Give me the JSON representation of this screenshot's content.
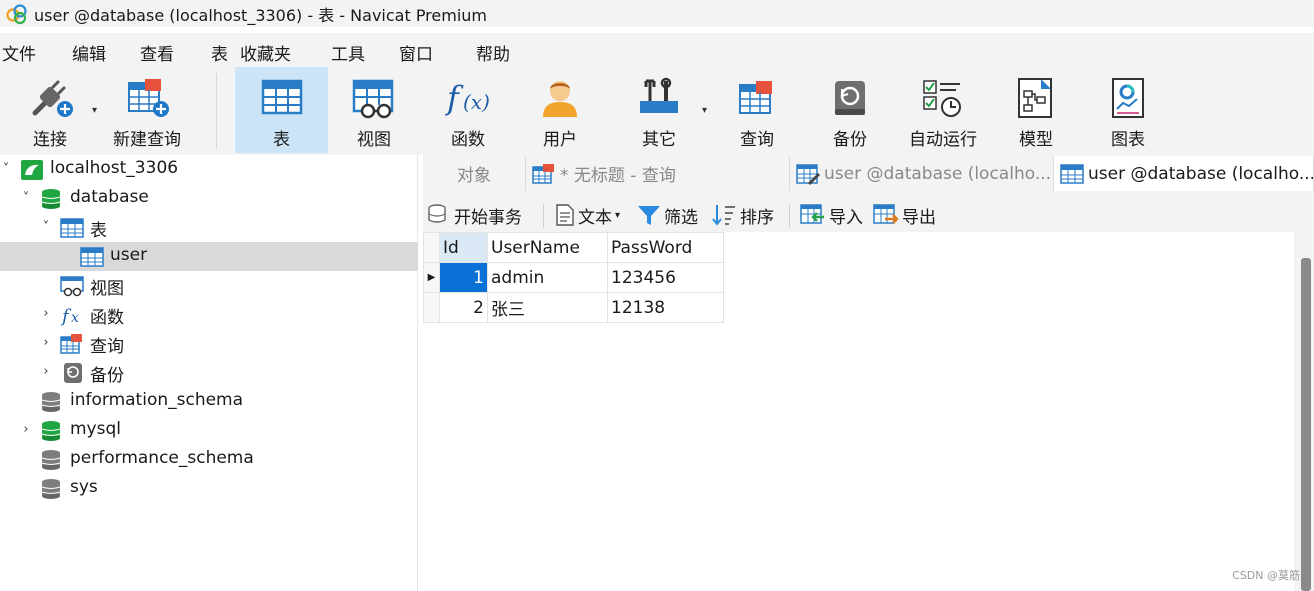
{
  "window": {
    "title": "user @database (localhost_3306) - 表 - Navicat Premium"
  },
  "menu": [
    "文件",
    "编辑",
    "查看",
    "表",
    "收藏夹",
    "工具",
    "窗口",
    "帮助"
  ],
  "toolbar": {
    "connect": "连接",
    "new_query": "新建查询",
    "table": "表",
    "view": "视图",
    "function": "函数",
    "user": "用户",
    "other": "其它",
    "query": "查询",
    "backup": "备份",
    "automation": "自动运行",
    "model": "模型",
    "chart": "图表"
  },
  "tree": {
    "connection": "localhost_3306",
    "database": "database",
    "tables_group": "表",
    "table_user": "user",
    "views": "视图",
    "functions": "函数",
    "queries": "查询",
    "backups": "备份",
    "db2": "information_schema",
    "db3": "mysql",
    "db4": "performance_schema",
    "db5": "sys"
  },
  "tabs": {
    "objects": "对象",
    "query_tab": "* 无标题 - 查询",
    "tab3": "user @database (localho...",
    "tab4": "user @database (localho..."
  },
  "subtoolbar": {
    "begin_transaction": "开始事务",
    "text": "文本",
    "filter": "筛选",
    "sort": "排序",
    "import": "导入",
    "export": "导出"
  },
  "grid": {
    "columns": [
      "Id",
      "UserName",
      "PassWord"
    ],
    "rows": [
      {
        "id": "1",
        "username": "admin",
        "password": "123456"
      },
      {
        "id": "2",
        "username": "张三",
        "password": "12138"
      }
    ]
  },
  "watermark": "CSDN @莫筋",
  "colors": {
    "selection": "#0a72d6",
    "active_tool": "#cce4f7",
    "db_green": "#1fa640"
  }
}
